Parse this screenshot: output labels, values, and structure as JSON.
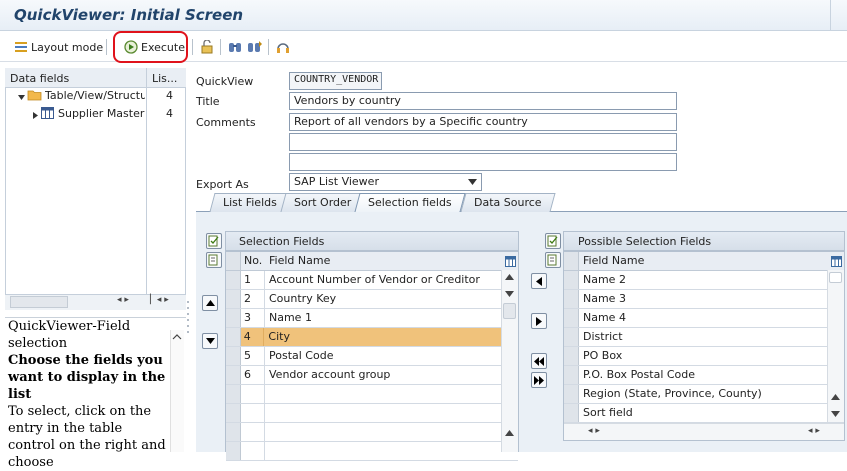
{
  "window": {
    "title": "QuickViewer: Initial Screen"
  },
  "toolbar": {
    "layout_mode_label": "Layout mode",
    "execute_label": "Execute"
  },
  "data_fields": {
    "col1": "Data fields",
    "col2": "Lis...",
    "tree": [
      {
        "label": "Table/View/Structur",
        "count": "4"
      },
      {
        "label": "Supplier Master (",
        "count": "4"
      }
    ]
  },
  "help": {
    "title": "QuickViewer-Field selection",
    "bold_text": "Choose the fields you want to display in the list",
    "body": "To select, click on the entry in the table control on the right and choose"
  },
  "form": {
    "quickview_label": "QuickView",
    "quickview_value": "COUNTRY_VENDOR",
    "title_label": "Title",
    "title_value": "Vendors by country",
    "comments_label": "Comments",
    "comments_value": "Report of all vendors by a Specific country",
    "comments_line2": "",
    "comments_line3": "",
    "export_label": "Export As",
    "export_value": "SAP List Viewer"
  },
  "tabs": [
    {
      "label": "List Fields"
    },
    {
      "label": "Sort Order"
    },
    {
      "label": "Selection fields"
    },
    {
      "label": "Data Source"
    }
  ],
  "selection_fields": {
    "title": "Selection Fields",
    "col_no": "No.",
    "col_field": "Field Name",
    "rows": [
      {
        "no": "1",
        "name": "Account Number of Vendor or Creditor"
      },
      {
        "no": "2",
        "name": "Country Key"
      },
      {
        "no": "3",
        "name": "Name 1"
      },
      {
        "no": "4",
        "name": "City"
      },
      {
        "no": "5",
        "name": "Postal Code"
      },
      {
        "no": "6",
        "name": "Vendor account group"
      }
    ]
  },
  "possible_fields": {
    "title": "Possible Selection Fields",
    "col_field": "Field Name",
    "rows": [
      {
        "name": "Name 2"
      },
      {
        "name": "Name 3"
      },
      {
        "name": "Name 4"
      },
      {
        "name": "District"
      },
      {
        "name": "PO Box"
      },
      {
        "name": "P.O. Box Postal Code"
      },
      {
        "name": "Region (State, Province, County)"
      },
      {
        "name": "Sort field"
      }
    ]
  },
  "colors": {
    "title": "#21446b",
    "highlight_row": "#f0c27b",
    "execute_outline": "#e0121b"
  }
}
